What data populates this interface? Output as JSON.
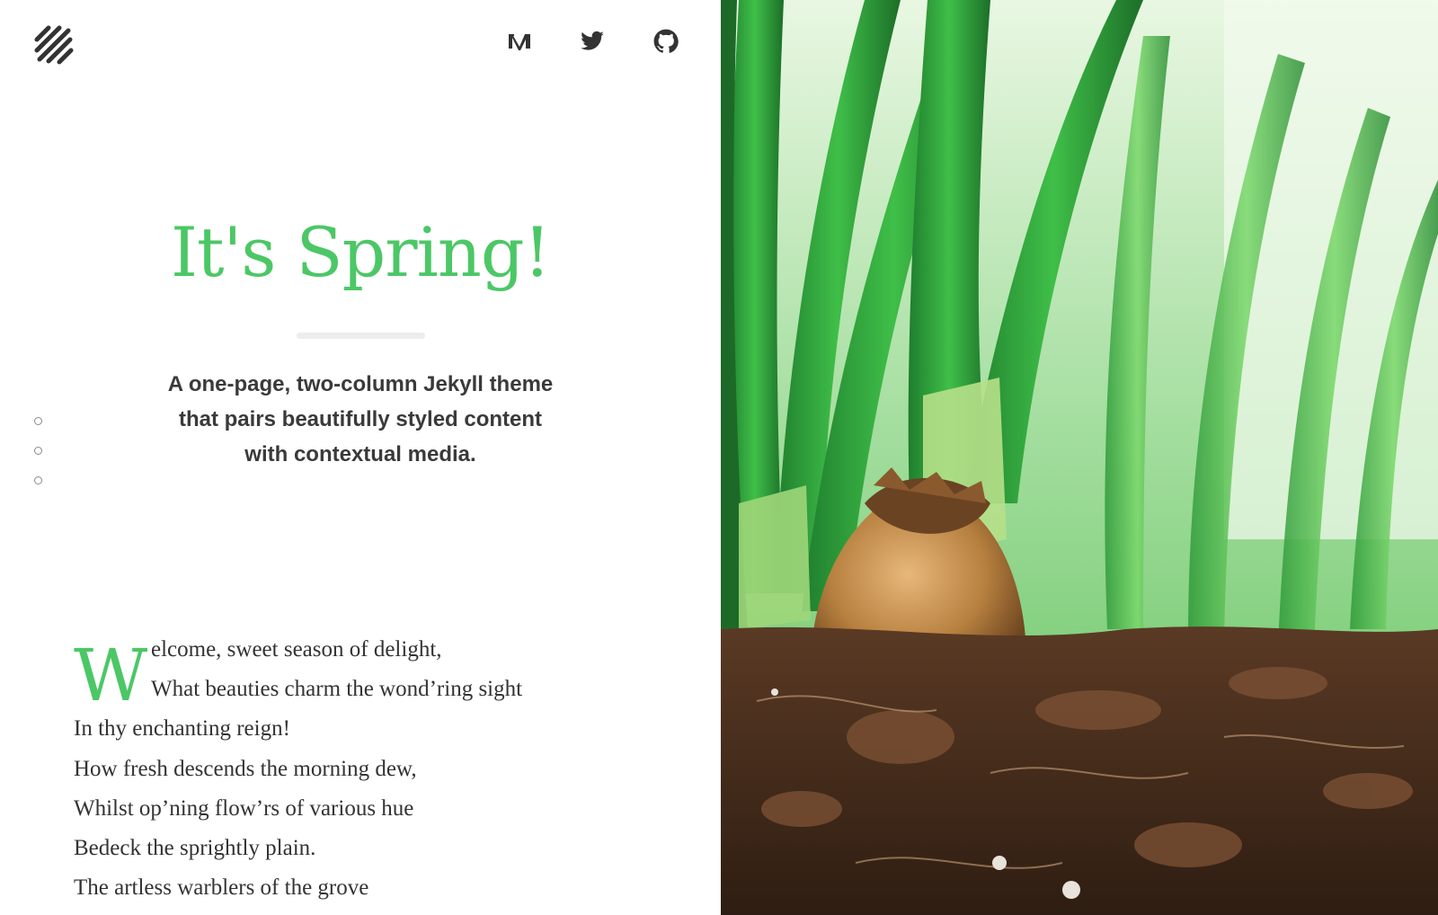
{
  "nav": {
    "logo_icon": "diagonal-stripes-logo-icon",
    "social": [
      {
        "name": "Medium",
        "icon": "medium-icon"
      },
      {
        "name": "Twitter",
        "icon": "twitter-icon"
      },
      {
        "name": "GitHub",
        "icon": "github-icon"
      }
    ]
  },
  "hero": {
    "title": "It's Spring!",
    "subtitle_lines": [
      "A one-page, two-column Jekyll theme",
      "that pairs beautifully styled content",
      "with contextual media."
    ]
  },
  "section_dots": {
    "count": 3
  },
  "poem": {
    "dropcap": "W",
    "first_line_rest": "elcome, sweet season of delight,",
    "lines": [
      "What beauties charm the wond’ring sight",
      "In thy enchanting reign!",
      "How fresh descends the morning dew,",
      "Whilst op’ning flow’rs of various hue",
      "Bedeck the sprightly plain.",
      "The artless warblers of the grove"
    ]
  },
  "media": {
    "image_subject": "spring bulbs sprouting green leaves from soil"
  },
  "colors": {
    "accent": "#4cc766",
    "text": "#333333",
    "subtitle": "#3a3a3a",
    "rule": "#ededed"
  }
}
